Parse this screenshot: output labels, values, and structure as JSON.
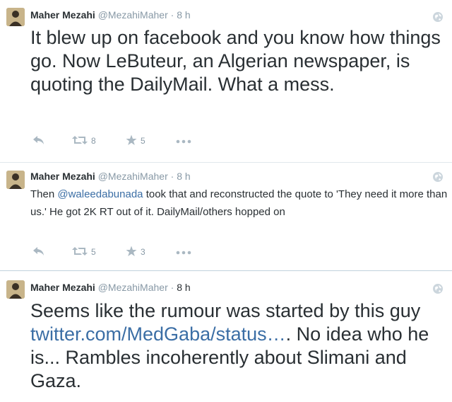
{
  "tweets": [
    {
      "name": "Maher Mezahi",
      "handle": "@MezahiMaher",
      "dot": "·",
      "time": "8 h",
      "text": "It blew up on facebook and you know how things go. Now LeButeur, an Algerian newspaper, is quoting the DailyMail. What a mess.",
      "retweets": "8",
      "favorites": "5"
    },
    {
      "name": "Maher Mezahi",
      "handle": "@MezahiMaher",
      "dot": "·",
      "time": "8 h",
      "text_before": "Then ",
      "mention": "@waleedabunada",
      "text_after": " took that and reconstructed the quote to 'They need it more than us.' He got 2K RT out of it. DailyMail/others hopped on",
      "retweets": "5",
      "favorites": "3"
    },
    {
      "name": "Maher Mezahi",
      "handle": "@MezahiMaher",
      "dot": "·",
      "time": "8 h",
      "text_before": "Seems like the rumour was started by this guy ",
      "link": "twitter.com/MedGaba/status…",
      "text_after": ". No idea who he is... Rambles incoherently about Slimani and Gaza."
    }
  ],
  "icons": {
    "reply": "reply-icon",
    "retweet": "retweet-icon",
    "favorite": "star-icon",
    "more": "more-icon",
    "globe": "globe-icon"
  },
  "colors": {
    "link": "#3b6ea5",
    "meta": "#8899a6",
    "divider": "#e1e8ed"
  }
}
